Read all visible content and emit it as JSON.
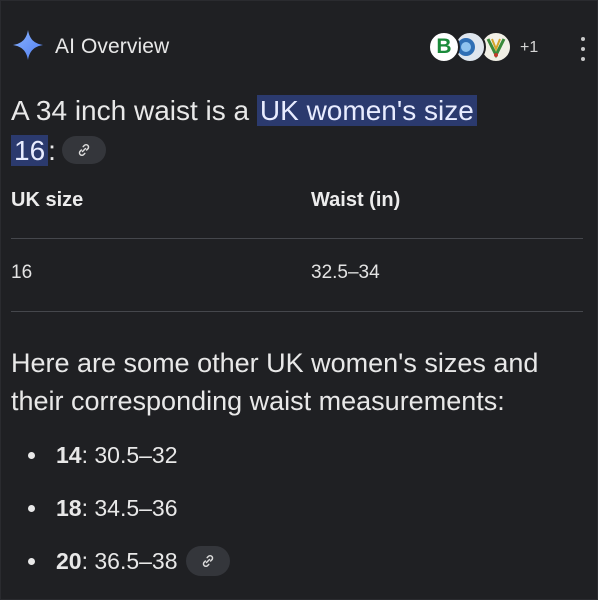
{
  "header": {
    "title": "AI Overview",
    "sparkle_icon": "gemini-sparkle-icon",
    "sources": {
      "favicons": [
        {
          "icon": "source-favicon-b",
          "letter": "B"
        },
        {
          "icon": "source-favicon-2"
        },
        {
          "icon": "source-favicon-3"
        }
      ],
      "more_count": "+1"
    },
    "menu_icon": "more-vert-icon"
  },
  "answer": {
    "prefix": "A 34 inch waist is a ",
    "highlight_line1": "UK women's size",
    "highlight_line2": "16",
    "suffix": ":"
  },
  "table": {
    "columns": [
      "UK size",
      "Waist (in)"
    ],
    "rows": [
      [
        "16",
        "32.5–34"
      ]
    ]
  },
  "paragraph": "Here are some other UK women's sizes and their corresponding waist measurements:",
  "sizes": [
    {
      "size": "14",
      "waist": ": 30.5–32"
    },
    {
      "size": "18",
      "waist": ": 34.5–36"
    },
    {
      "size": "20",
      "waist": ": 36.5–38"
    }
  ],
  "colors": {
    "background": "#1f2023",
    "highlight": "#2b3a6e",
    "chip": "#34363b",
    "text": "#e8e8e8"
  }
}
